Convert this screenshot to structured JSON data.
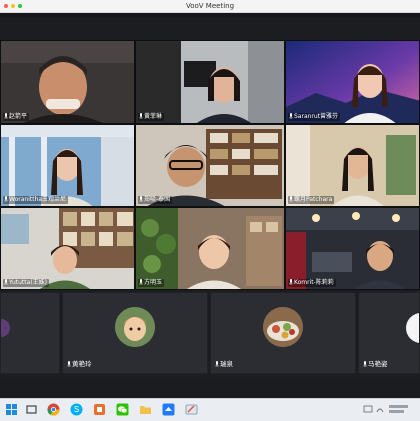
{
  "window": {
    "title": "VooV Meeting"
  },
  "participants": [
    {
      "name": "赵箭平"
    },
    {
      "name": "黄菲琳"
    },
    {
      "name": "Saranrut曾雅芬"
    },
    {
      "name": "Woranittha王观兰尼"
    },
    {
      "name": "郑吸-泰国"
    },
    {
      "name": "螺月Patchara"
    },
    {
      "name": "Yututta(王姝)"
    },
    {
      "name": "方明玉"
    },
    {
      "name": "Komrit-陈莉莉"
    }
  ],
  "bottom_participants": [
    {
      "name": ""
    },
    {
      "name": "黄艳玲"
    },
    {
      "name": "瑞泉"
    },
    {
      "name": "马艳姿"
    }
  ],
  "taskbar": {
    "apps": [
      "windows-start",
      "chrome",
      "skype",
      "office",
      "wechat",
      "folder",
      "voov-meeting",
      "paint"
    ]
  },
  "colors": {
    "accent": "#1f7bff",
    "background": "#1c1d21"
  }
}
